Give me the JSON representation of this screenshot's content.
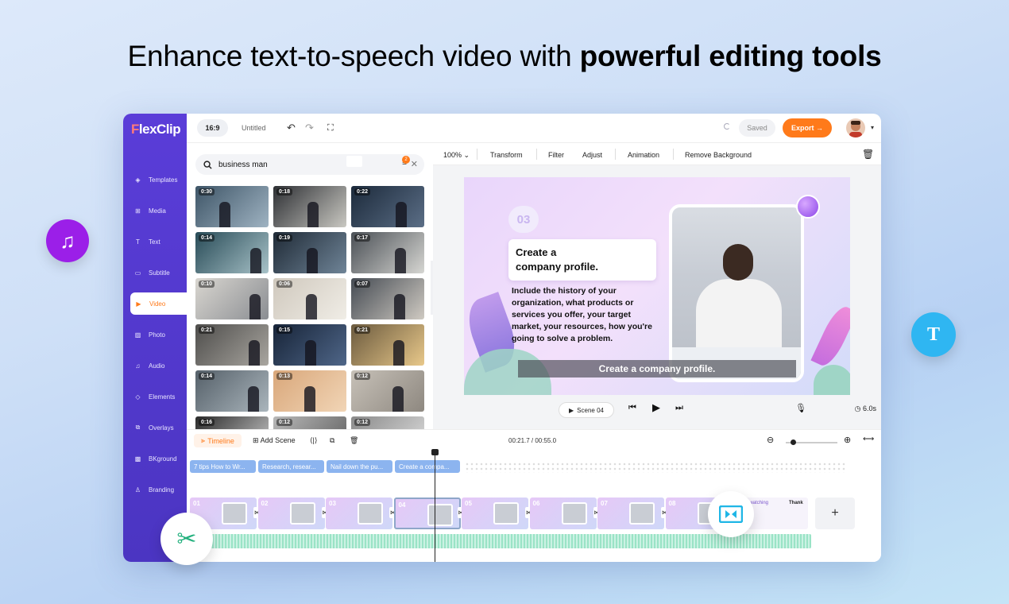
{
  "headline": {
    "normal": "Enhance text-to-speech video with ",
    "bold": "powerful editing tools"
  },
  "app": {
    "logo": {
      "first": "F",
      "rest": "lexClip"
    },
    "topbar": {
      "ratio": "16:9",
      "title": "Untitled",
      "saved": "Saved",
      "export": "Export →"
    },
    "sidebar": [
      {
        "label": "Templates",
        "icon": "layers-icon"
      },
      {
        "label": "Media",
        "icon": "folder-plus-icon"
      },
      {
        "label": "Text",
        "icon": "text-icon"
      },
      {
        "label": "Subtitle",
        "icon": "subtitle-icon"
      },
      {
        "label": "Video",
        "icon": "video-icon",
        "active": true
      },
      {
        "label": "Photo",
        "icon": "photo-icon"
      },
      {
        "label": "Audio",
        "icon": "music-icon"
      },
      {
        "label": "Elements",
        "icon": "elements-icon"
      },
      {
        "label": "Overlays",
        "icon": "overlays-icon"
      },
      {
        "label": "BKground",
        "icon": "background-icon"
      },
      {
        "label": "Branding",
        "icon": "branding-icon"
      }
    ],
    "search": {
      "value": "business man",
      "filter_count": "2"
    },
    "thumbs": [
      "0:30",
      "0:18",
      "0:22",
      "0:14",
      "0:19",
      "0:17",
      "0:10",
      "0:06",
      "0:07",
      "0:21",
      "0:15",
      "0:21",
      "0:14",
      "0:13",
      "0:12",
      "0:16",
      "0:12",
      "0:12"
    ],
    "preview_toolbar": {
      "zoom": "100%",
      "transform": "Transform",
      "filter": "Filter",
      "adjust": "Adjust",
      "animation": "Animation",
      "remove_bg": "Remove Background"
    },
    "canvas": {
      "number": "03",
      "title_line1": "Create a",
      "title_line2": "company profile.",
      "body": "Include the history of your organization, what products or services you offer, your target market, your resources, how you're going to solve a problem.",
      "subtitle": "Create a company profile."
    },
    "playback": {
      "scene": "Scene 04",
      "duration": "6.0s"
    },
    "timeline": {
      "tab": "Timeline",
      "add_scene": "Add Scene",
      "time": "00:21.7 / 00:55.0",
      "chips": [
        "7 tips How to Wr...",
        "Research, resear...",
        "Nail down the pu...",
        "Create a compa..."
      ],
      "scenes": [
        "01",
        "02",
        "03",
        "04",
        "05",
        "06",
        "07",
        "08"
      ],
      "last_thumb_text_a": "ks for watching",
      "last_thumb_text_b": "Thank"
    }
  },
  "colors": {
    "sidebar": "#5a3dd8",
    "accent": "#ff7a1a",
    "audio_fab": "#9b1fe8",
    "text_fab": "#2fb6f2",
    "cut_fab": "#22b07d",
    "split_fab": "#1fb6e6"
  }
}
